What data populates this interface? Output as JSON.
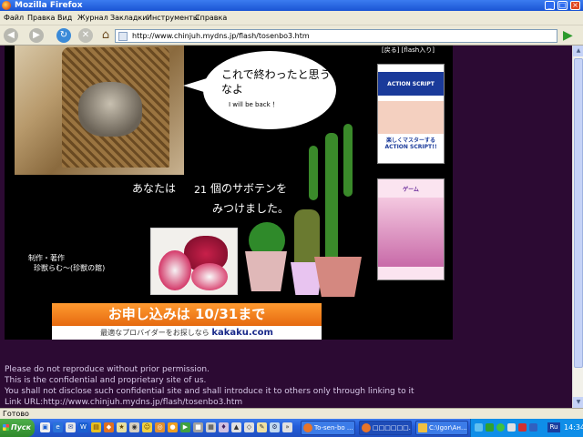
{
  "window": {
    "title": "Mozilla Firefox"
  },
  "menu": [
    "Файл",
    "Правка",
    "Вид",
    "Журнал",
    "Закладки",
    "Инструменты",
    "Справка"
  ],
  "nav": {
    "url": "http://www.chinjuh.mydns.jp/flash/tosenbo3.htm"
  },
  "flash": {
    "top_link": "[戻る] [flash入り]",
    "bubble_line1": "これで終わったと思うなよ",
    "bubble_line2": "I will be back ！",
    "found_prefix": "あなたは",
    "found_count": "21",
    "found_suffix": "個のサボテンを",
    "found_line2": "みつけました。",
    "credit_line1": "制作・著作",
    "credit_line2": "珍獣らむ～(珍獣の館)"
  },
  "books": [
    {
      "title": "ACTION SCRIPT",
      "subtitle": "楽しくマスターする ACTION SCRIPT!!"
    },
    {
      "title": "ゲーム"
    }
  ],
  "banner": {
    "main": "お申し込みは 10/31まで",
    "sub": "最適なプロバイダーをお探しなら",
    "brand": "kakaku.com"
  },
  "notice": [
    "Please do not reproduce without prior permission.",
    "This is the confidential and proprietary site of us.",
    "You shall not disclose such confidential site and shall introduce it to others only through linking to it",
    "Link URL:http://www.chinjuh.mydns.jp/flash/tosenbo3.htm"
  ],
  "status": "Готово",
  "taskbar": {
    "start": "Пуск",
    "tasks": [
      "To-sen-bo ...",
      "□□□□□□...",
      "C:\\Igor\\Ан..."
    ],
    "lang": "Ru",
    "clock": "14:34"
  },
  "colors": {
    "page_bg": "#2c0a33",
    "flash_bg": "#000000",
    "banner_orange": "#f28220"
  }
}
